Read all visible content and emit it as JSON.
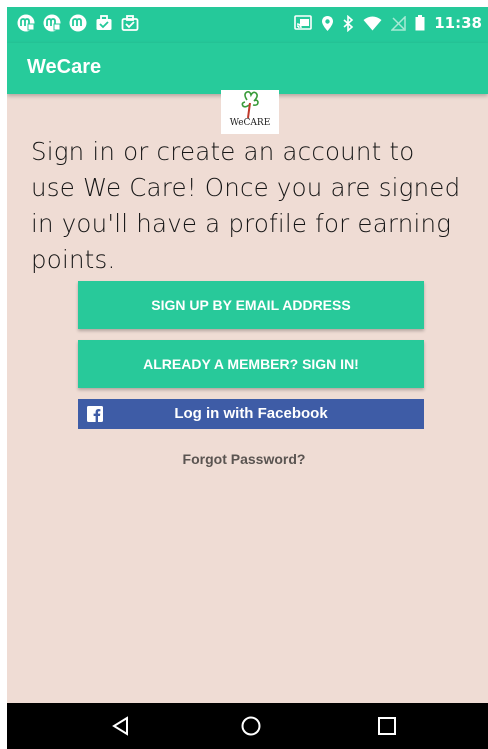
{
  "status_bar": {
    "time": "11:38",
    "left_icons": [
      "notification-app-icon",
      "notification-app-icon",
      "notification-app-icon",
      "briefcase-icon",
      "briefcase-check-icon"
    ],
    "right_icons": [
      "cast-icon",
      "location-icon",
      "bluetooth-icon",
      "wifi-icon",
      "no-signal-icon",
      "battery-icon"
    ]
  },
  "app_bar": {
    "title": "WeCare"
  },
  "logo": {
    "text": "WeCARE"
  },
  "intro_text": "Sign in or create an account to use We Care! Once you are signed in you'll have a profile for earning points.",
  "buttons": {
    "signup_email": "SIGN UP BY EMAIL ADDRESS",
    "signin_member": "ALREADY A MEMBER? SIGN IN!",
    "facebook": "Log in with Facebook"
  },
  "forgot_password": "Forgot Password?",
  "colors": {
    "accent": "#27cb9b",
    "background": "#efdcd4",
    "facebook": "#3e5ca6",
    "navbar": "#000000"
  }
}
